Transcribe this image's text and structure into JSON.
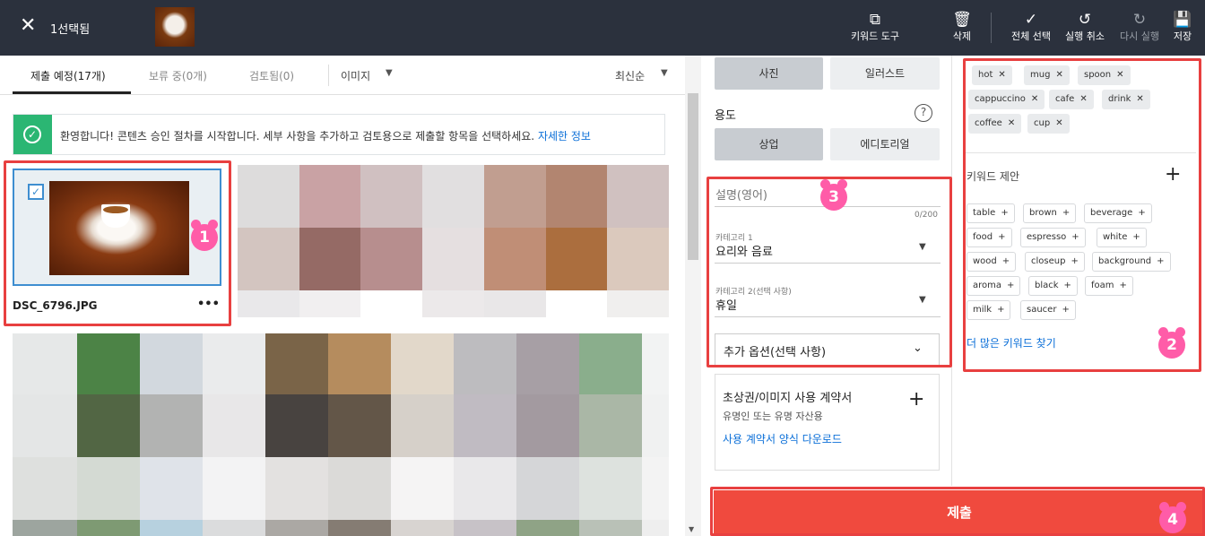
{
  "topbar": {
    "close_icon": "close-icon",
    "selected_count": "1선택됨",
    "keyword_tool": "키워드 도구",
    "delete": "삭제",
    "select_all": "전체 선택",
    "undo": "실행 취소",
    "redo": "다시 실행",
    "save": "저장"
  },
  "tabs": {
    "items": [
      "제출 예정(17개)",
      "보류 중(0개)",
      "검토됨(0)"
    ],
    "type_filter": "이미지",
    "sort": "최신순"
  },
  "banner": {
    "text": "환영합니다! 콘텐츠 승인 절차를 시작합니다. 세부 사항을 추가하고 검토용으로 제출할 항목을 선택하세요.",
    "link": "자세한 정보"
  },
  "selected_file": {
    "name": "DSC_6796.JPG",
    "more": "•••"
  },
  "form": {
    "type_options": [
      "사진",
      "일러스트"
    ],
    "usage_label": "용도",
    "usage_options": [
      "상업",
      "에디토리얼"
    ],
    "description_placeholder": "설명(영어)",
    "char_count": "0/200",
    "category1_label": "카테고리 1",
    "category1_value": "요리와 음료",
    "category2_label": "카테고리 2(선택 사항)",
    "category2_value": "휴일",
    "more_options": "추가 옵션(선택 사항)",
    "release_title": "초상권/이미지 사용 계약서",
    "release_sub": "유명인 또는 유명 자산용",
    "release_link": "사용 계약서 양식 다운로드",
    "submit": "제출"
  },
  "keywords": {
    "selected": [
      "hot",
      "mug",
      "spoon",
      "cappuccino",
      "cafe",
      "drink",
      "coffee",
      "cup"
    ],
    "suggest_title": "키워드 제안",
    "suggestions": [
      "table",
      "brown",
      "beverage",
      "food",
      "espresso",
      "white",
      "wood",
      "closeup",
      "background",
      "aroma",
      "black",
      "foam",
      "milk",
      "saucer"
    ],
    "more_link": "더 많은 키워드 찾기"
  },
  "markers": [
    "1",
    "2",
    "3",
    "4"
  ],
  "colors": {
    "accent_red": "#f04a3e",
    "topbar": "#2b313d",
    "success": "#2bb673"
  }
}
